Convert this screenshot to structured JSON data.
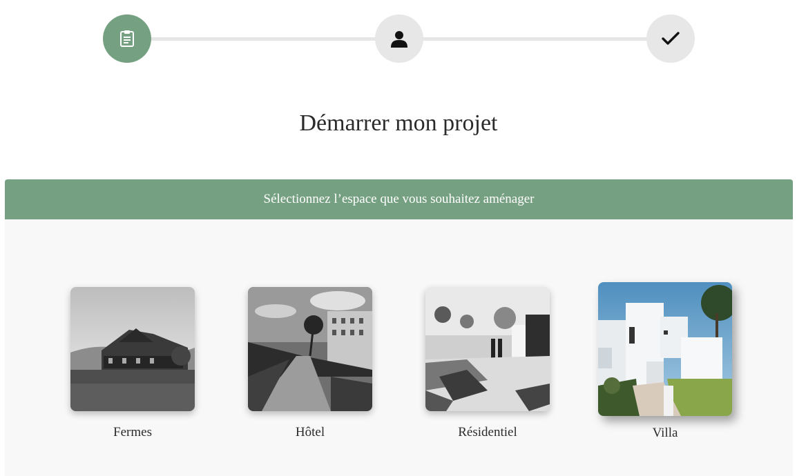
{
  "stepper": {
    "steps": [
      {
        "icon": "clipboard-icon",
        "state": "active"
      },
      {
        "icon": "user-icon",
        "state": "inactive"
      },
      {
        "icon": "checkmark-icon",
        "state": "inactive"
      }
    ],
    "colors": {
      "active": "#76a082",
      "inactive": "#e7e7e7",
      "track": "#e6e6e6"
    }
  },
  "page": {
    "title": "Démarrer mon projet"
  },
  "panel": {
    "header": "Sélectionnez l’espace que vous souhaitez aménager",
    "header_color": "#76a082",
    "options": [
      {
        "label": "Fermes",
        "image": "farmhouse-photo",
        "style": "grayscale"
      },
      {
        "label": "Hôtel",
        "image": "hotel-photo",
        "style": "grayscale"
      },
      {
        "label": "Résidentiel",
        "image": "residential-photo",
        "style": "grayscale"
      },
      {
        "label": "Villa",
        "image": "villa-photo",
        "style": "color",
        "selected": true
      }
    ]
  }
}
